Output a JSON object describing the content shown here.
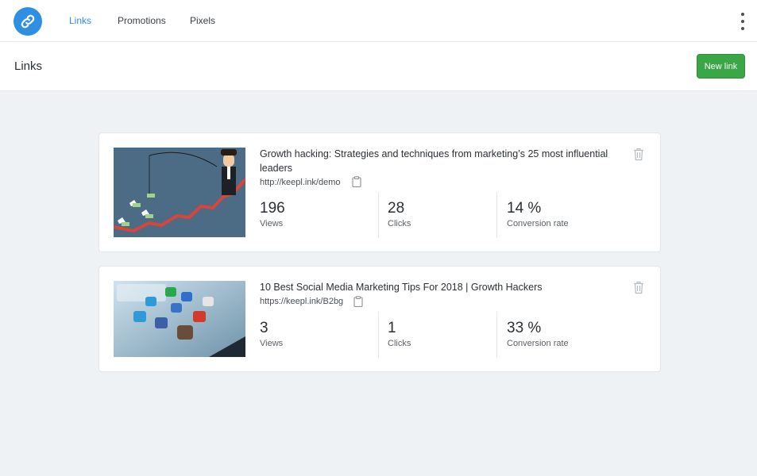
{
  "nav": {
    "items": [
      {
        "label": "Links",
        "active": true
      },
      {
        "label": "Promotions",
        "active": false
      },
      {
        "label": "Pixels",
        "active": false
      }
    ]
  },
  "page": {
    "title": "Links",
    "new_link_label": "New link"
  },
  "links": [
    {
      "title": "Growth hacking: Strategies and techniques from marketing’s 25 most influential leaders",
      "url": "http://keepl.ink/demo",
      "stats": [
        {
          "value": "196",
          "label": "Views"
        },
        {
          "value": "28",
          "label": "Clicks"
        },
        {
          "value": "14 %",
          "label": "Conversion rate"
        }
      ]
    },
    {
      "title": "10 Best Social Media Marketing Tips For 2018 | Growth Hackers",
      "url": "https://keepl.ink/B2bg",
      "stats": [
        {
          "value": "3",
          "label": "Views"
        },
        {
          "value": "1",
          "label": "Clicks"
        },
        {
          "value": "33 %",
          "label": "Conversion rate"
        }
      ]
    }
  ],
  "colors": {
    "accent": "#2f8fe0",
    "primary_button": "#3aa646",
    "background": "#eef2f5"
  }
}
